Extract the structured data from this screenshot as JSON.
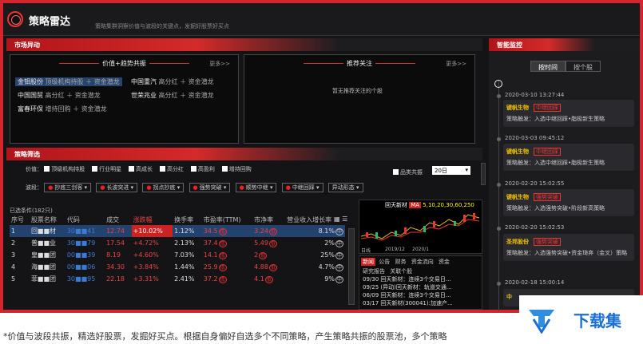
{
  "app": {
    "title": "策略雷达",
    "subtitle": "策略集群洞察价值与波段的关键点，发掘好股票好买点"
  },
  "market": {
    "header": "市场异动",
    "hot": {
      "title": "价值+趋势共振",
      "more": "更多>>",
      "items": [
        {
          "name": "金钼股份",
          "tags": "顶级机构持股 ＋ 资金潜龙"
        },
        {
          "name": "中国重汽",
          "tags": "高分红 ＋ 资金潜龙"
        },
        {
          "name": "中国国贸",
          "tags": "高分红 ＋ 资金潜龙"
        },
        {
          "name": "世荣兆业",
          "tags": "高分红 ＋ 资金潜龙"
        },
        {
          "name": "富春环保",
          "tags": "增持回购 ＋ 资金潜龙"
        }
      ]
    },
    "watch": {
      "title": "推荐关注",
      "more": "更多>>",
      "empty": "暂无推荐关注的个股"
    }
  },
  "screen": {
    "header": "策略筛选",
    "value_label": "价值：",
    "value_opts": [
      "顶级机构持股",
      "行业明星",
      "高成长",
      "高分红",
      "高盈利",
      "增持回购"
    ],
    "wave_label": "波段：",
    "wave_opts": [
      "抄底三剑客",
      "长波突进",
      "拐点抄底",
      "强势突破",
      "顺势中继",
      "中继回踩",
      "异动形态"
    ],
    "only_pool": "品类共振",
    "period": "20日",
    "selected": "已选条件(182只)",
    "columns": [
      "序号",
      "股票名称",
      "代码",
      "成交",
      "涨跌幅",
      "换手率",
      "市盈率(TTM)",
      "市净率",
      "营业收入增长率"
    ],
    "rows": [
      {
        "idx": "1",
        "name": "回■■材",
        "code": "30■■41",
        "price": "12.74",
        "chg": "+10.02%",
        "turn": "1.12%",
        "pe": "34.5",
        "pb": "3.24",
        "grow": "8.1%"
      },
      {
        "idx": "2",
        "name": "普■■业",
        "code": "30■■79",
        "price": "17.54",
        "chg": "+4.72%",
        "turn": "2.13%",
        "pe": "37.4",
        "pb": "5.49",
        "grow": "2%"
      },
      {
        "idx": "3",
        "name": "皇■■团",
        "code": "00■■39",
        "price": "8.19",
        "chg": "+4.60%",
        "turn": "7.03%",
        "pe": "14.1",
        "pb": "2",
        "grow": "25%"
      },
      {
        "idx": "4",
        "name": "海■■团",
        "code": "00■■06",
        "price": "34.30",
        "chg": "+3.84%",
        "turn": "1.44%",
        "pe": "25.9",
        "pb": "4.88",
        "grow": "4.7%"
      },
      {
        "idx": "5",
        "name": "菲■■团",
        "code": "30■■95",
        "price": "22.18",
        "chg": "+3.31%",
        "turn": "2.41%",
        "pe": "37.2",
        "pb": "4.1",
        "grow": "9%"
      }
    ]
  },
  "chart": {
    "title": "回天新材",
    "badge": "MA",
    "ma": "5,10,20,30,60,250",
    "xl": "2019/12",
    "xr": "2020/1",
    "period": "日线"
  },
  "news": {
    "tabs": [
      "新闻",
      "公告",
      "财务",
      "资金流向",
      "资金"
    ],
    "sub": [
      "研究报告",
      "关联个股"
    ],
    "items": [
      {
        "date": "09/30",
        "text": "回天新材：连续3个交易日..."
      },
      {
        "date": "09/25",
        "text": "(异动)回天新材：轨道交通..."
      },
      {
        "date": "06/09",
        "text": "回天新材：连续3个交易日..."
      },
      {
        "date": "03/17",
        "text": "回天新材(300041):加速产..."
      }
    ]
  },
  "monitor": {
    "header": "智能监控",
    "tabs": [
      "按时间",
      "按个股"
    ],
    "entries": [
      {
        "time": "2020-03-10 13:27:44",
        "name": "键帆生物",
        "tag": "中继回踩",
        "text": "策略触发：入选中继回踩•脂极新生策略"
      },
      {
        "time": "2020-03-03 09:45:12",
        "name": "键帆生物",
        "tag": "中继回踩",
        "text": "策略触发：入选中继回踩•脂极新生策略"
      },
      {
        "time": "2020-02-20 15:02:55",
        "name": "键帆生物",
        "tag": "强势突破",
        "text": "策略触发：入选强势突破•阶段新高策略"
      },
      {
        "time": "2020-02-20 15:02:53",
        "name": "圣邦股份",
        "tag": "强势突破",
        "text": "策略触发：入选强势突破•资金琦弃（金叉）策略"
      },
      {
        "time": "2020-02-18 15:00:14",
        "name": "中",
        "tag": "",
        "text": ""
      }
    ]
  },
  "caption": "*价值与波段共振，精选好股票，发掘好买点。根据自身偏好自选多个不同策略，产生策略共振的股票池，多个策略",
  "watermark": "下载集",
  "colors": {
    "accent": "#d4252f",
    "up": "#e44",
    "gold": "#f0c000",
    "select": "#23426e"
  }
}
